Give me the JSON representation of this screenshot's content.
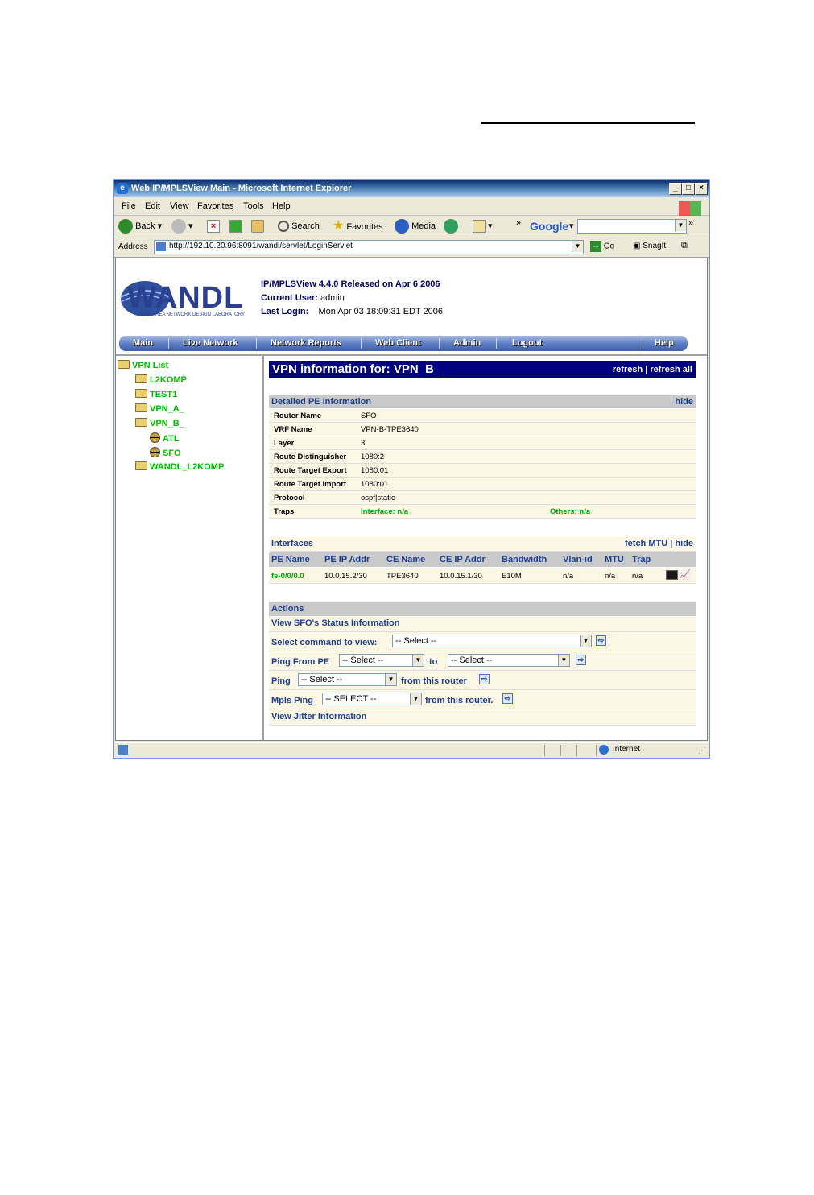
{
  "window": {
    "title": "Web IP/MPLSView Main - Microsoft Internet Explorer",
    "ie_icon": "ie-icon",
    "controls": [
      "_",
      "□",
      "×"
    ]
  },
  "menu": [
    "File",
    "Edit",
    "View",
    "Favorites",
    "Tools",
    "Help"
  ],
  "toolbar": {
    "back": "Back",
    "search": "Search",
    "favorites": "Favorites",
    "media": "Media",
    "google": "Google",
    "more": "»"
  },
  "address": {
    "label": "Address",
    "url": "http://192.10.20.96:8091/wandl/servlet/LoginServlet",
    "go": "Go",
    "snagit": "SnagIt"
  },
  "app": {
    "logo_text": "WANDL",
    "logo_sub": "WIDE AREA NETWORK DESIGN LABORATORY",
    "release": "IP/MPLSView 4.4.0 Released on Apr 6 2006",
    "user_label": "Current User:",
    "user": "admin",
    "login_label": "Last Login:",
    "login": "Mon Apr 03 18:09:31 EDT 2006",
    "nav": [
      "Main",
      "Live Network",
      "Network Reports",
      "Web Client",
      "Admin",
      "Logout",
      "Help"
    ]
  },
  "tree": {
    "root": "VPN List",
    "items": [
      "L2KOMP",
      "TEST1",
      "VPN_A_",
      "VPN_B_",
      "WANDL_L2KOMP"
    ],
    "children": [
      "ATL",
      "SFO"
    ]
  },
  "vpn": {
    "title": "VPN information for: VPN_B_",
    "refresh": "refresh",
    "sep": "|",
    "refresh_all": "refresh all"
  },
  "pe": {
    "title": "Detailed PE Information",
    "hide": "hide",
    "rows": [
      {
        "k": "Router Name",
        "v": "SFO"
      },
      {
        "k": "VRF Name",
        "v": "VPN-B-TPE3640"
      },
      {
        "k": "Layer",
        "v": "3"
      },
      {
        "k": "Route Distinguisher",
        "v": "1080:2"
      },
      {
        "k": "Route Target Export",
        "v": "1080:01"
      },
      {
        "k": "Route Target Import",
        "v": "1080:01"
      },
      {
        "k": "Protocol",
        "v": "ospf|static"
      }
    ],
    "traps_label": "Traps",
    "traps_interface": "Interface: n/a",
    "traps_others": "Others: n/a"
  },
  "interfaces": {
    "title": "Interfaces",
    "fetch": "fetch MTU",
    "sep": "|",
    "hide": "hide",
    "headers": [
      "PE Name",
      "PE IP Addr",
      "CE Name",
      "CE IP Addr",
      "Bandwidth",
      "Vlan-id",
      "MTU",
      "Trap"
    ],
    "row": [
      "fe-0/0/0.0",
      "10.0.15.2/30",
      "TPE3640",
      "10.0.15.1/30",
      "E10M",
      "n/a",
      "n/a",
      "n/a"
    ]
  },
  "actions": {
    "title": "Actions",
    "status": "View SFO's Status Information",
    "select_cmd": "Select command to view:",
    "select_val": "-- Select --",
    "ping_from": "Ping From PE",
    "to": "to",
    "ping": "Ping",
    "from_router": "from this router",
    "mpls_ping": "Mpls Ping",
    "mpls_val": "-- SELECT --",
    "from_router2": "from this router.",
    "jitter": "View Jitter Information"
  },
  "status": {
    "zone": "Internet"
  }
}
